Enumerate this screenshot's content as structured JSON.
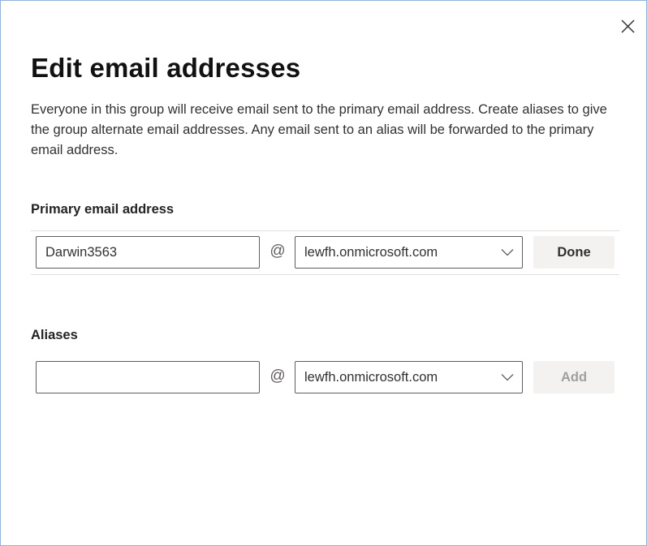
{
  "dialog": {
    "title": "Edit email addresses",
    "description": "Everyone in this group will receive email sent to the primary email address. Create aliases to give the group alternate email addresses. Any email sent to an alias will be forwarded to the primary email address.",
    "close_icon": "close-icon"
  },
  "primary": {
    "label": "Primary email address",
    "username_value": "Darwin3563",
    "at_symbol": "@",
    "domain_selected": "lewfh.onmicrosoft.com",
    "dropdown_icon": "chevron-down-icon",
    "done_label": "Done"
  },
  "aliases": {
    "label": "Aliases",
    "alias_value": "",
    "at_symbol": "@",
    "domain_selected": "lewfh.onmicrosoft.com",
    "dropdown_icon": "chevron-down-icon",
    "add_label": "Add",
    "add_enabled": false
  }
}
